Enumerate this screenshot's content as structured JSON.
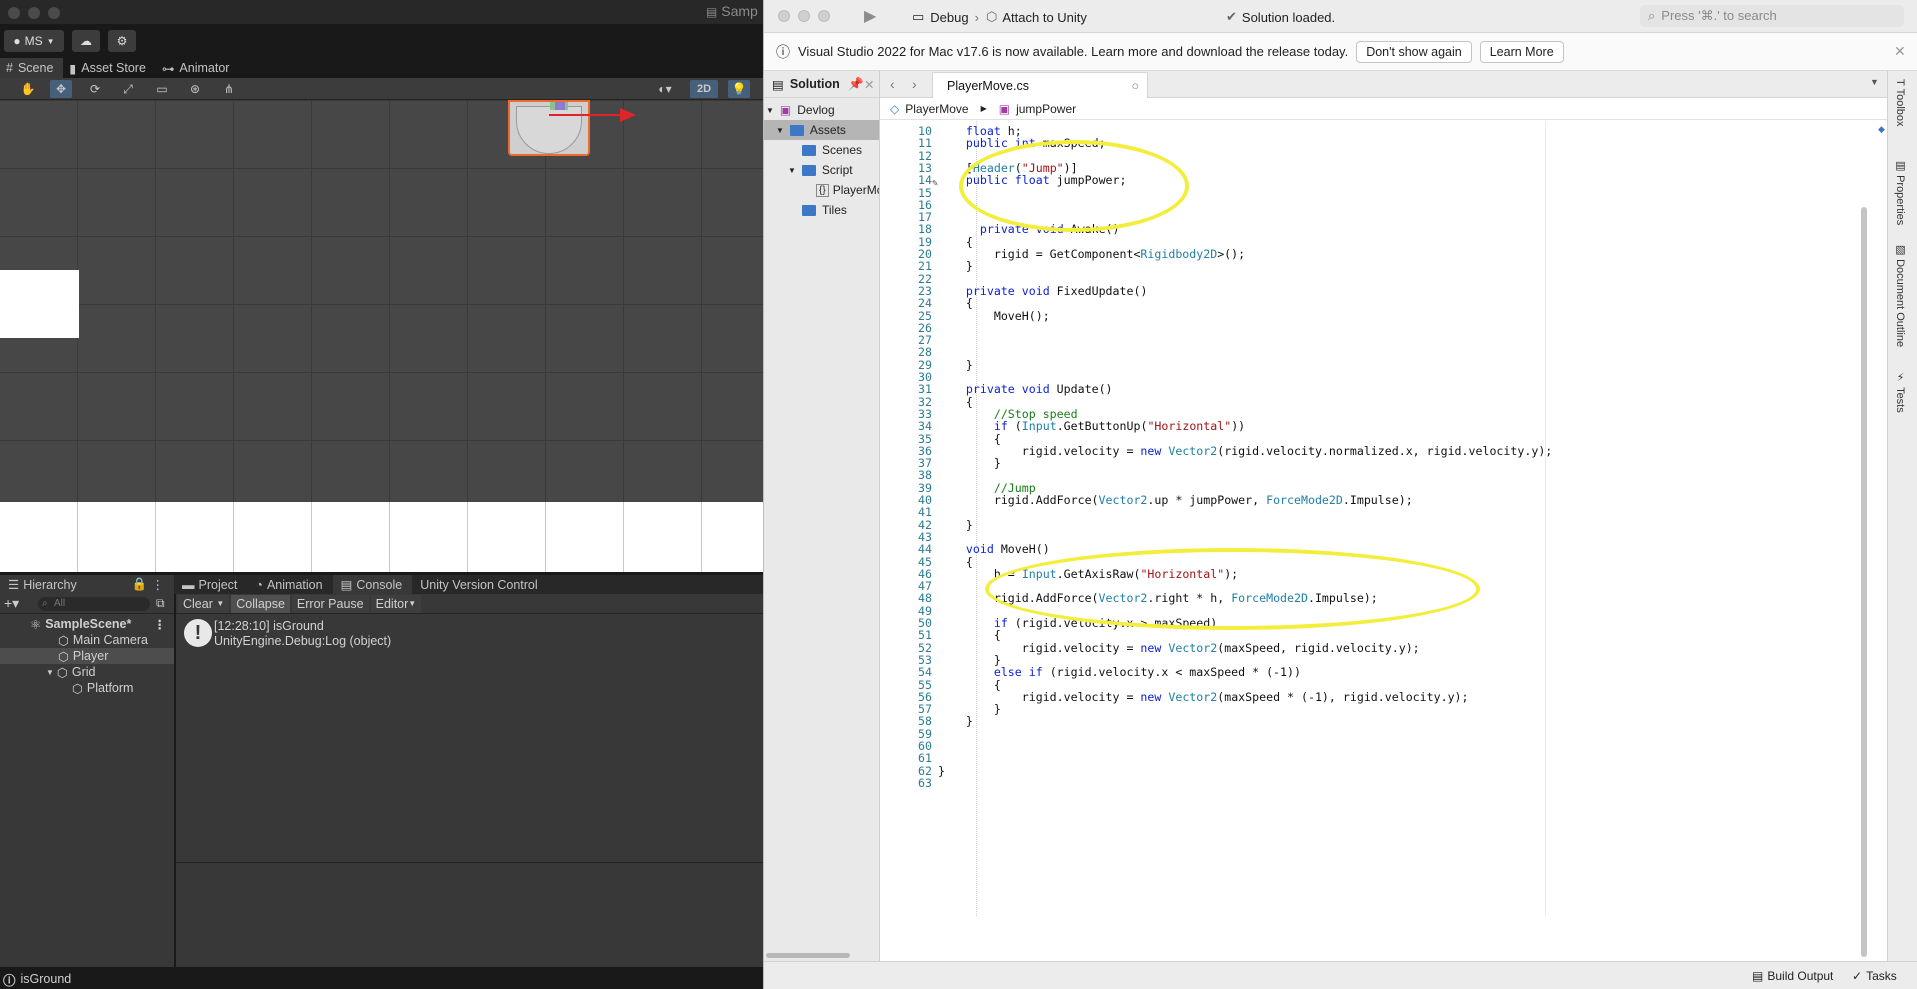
{
  "unity": {
    "window_title": "Samp",
    "account": "MS",
    "scene_tabs": [
      "Scene",
      "Asset Store",
      "Animator"
    ],
    "mode_2d": "2D",
    "bottom_tabs": [
      "Hierarchy",
      "Project",
      "Animation",
      "Console",
      "Unity Version Control"
    ],
    "hierarchy_search_placeholder": "All",
    "hierarchy_items": [
      {
        "label": "SampleScene*",
        "icon": "unity-scene-icon",
        "level": 0
      },
      {
        "label": "Main Camera",
        "icon": "gameobject-icon",
        "level": 1
      },
      {
        "label": "Player",
        "icon": "gameobject-icon",
        "level": 1,
        "selected": true
      },
      {
        "label": "Grid",
        "icon": "gameobject-icon",
        "level": 1
      },
      {
        "label": "Platform",
        "icon": "gameobject-icon",
        "level": 2
      }
    ],
    "console_buttons": [
      "Clear",
      "Collapse",
      "Error Pause",
      "Editor"
    ],
    "console_log": {
      "line1": "[12:28:10] isGround",
      "line2": "UnityEngine.Debug:Log (object)"
    },
    "status_text": "isGround"
  },
  "vs": {
    "config": "Debug",
    "target": "Attach to Unity",
    "status": "Solution loaded.",
    "search_placeholder": "Press '⌘.' to search",
    "info_message": "Visual Studio 2022 for Mac v17.6 is now available. Learn more and download the release today.",
    "info_buttons": [
      "Don't show again",
      "Learn More"
    ],
    "solution_title": "Solution",
    "solution_items": [
      {
        "label": "Devlog",
        "level": 0,
        "kind": "solution"
      },
      {
        "label": "Assets",
        "level": 1,
        "kind": "folder",
        "selected": true
      },
      {
        "label": "Scenes",
        "level": 2,
        "kind": "folder"
      },
      {
        "label": "Script",
        "level": 2,
        "kind": "folder"
      },
      {
        "label": "PlayerMc",
        "level": 3,
        "kind": "file"
      },
      {
        "label": "Tiles",
        "level": 2,
        "kind": "folder"
      }
    ],
    "tab_label": "PlayerMove.cs",
    "breadcrumb": [
      "PlayerMove",
      "jumpPower"
    ],
    "right_panels": [
      "Toolbox",
      "Properties",
      "Document Outline",
      "Tests"
    ],
    "bottom_buttons": [
      "Build Output",
      "Tasks"
    ],
    "code_lines": [
      {
        "n": 10,
        "t": "    float h;"
      },
      {
        "n": 11,
        "t": "    public int maxSpeed;"
      },
      {
        "n": 12,
        "t": ""
      },
      {
        "n": 13,
        "t": "    [Header(\"Jump\")]"
      },
      {
        "n": 14,
        "t": "    public float jumpPower;"
      },
      {
        "n": 15,
        "t": ""
      },
      {
        "n": 16,
        "t": ""
      },
      {
        "n": 17,
        "t": ""
      },
      {
        "n": 18,
        "t": "      private void Awake()"
      },
      {
        "n": 19,
        "t": "    {"
      },
      {
        "n": 20,
        "t": "        rigid = GetComponent<Rigidbody2D>();"
      },
      {
        "n": 21,
        "t": "    }"
      },
      {
        "n": 22,
        "t": ""
      },
      {
        "n": 23,
        "t": "    private void FixedUpdate()"
      },
      {
        "n": 24,
        "t": "    {"
      },
      {
        "n": 25,
        "t": "        MoveH();"
      },
      {
        "n": 26,
        "t": ""
      },
      {
        "n": 27,
        "t": ""
      },
      {
        "n": 28,
        "t": ""
      },
      {
        "n": 29,
        "t": "    }"
      },
      {
        "n": 30,
        "t": ""
      },
      {
        "n": 31,
        "t": "    private void Update()"
      },
      {
        "n": 32,
        "t": "    {"
      },
      {
        "n": 33,
        "t": "        //Stop speed"
      },
      {
        "n": 34,
        "t": "        if (Input.GetButtonUp(\"Horizontal\"))"
      },
      {
        "n": 35,
        "t": "        {"
      },
      {
        "n": 36,
        "t": "            rigid.velocity = new Vector2(rigid.velocity.normalized.x, rigid.velocity.y);"
      },
      {
        "n": 37,
        "t": "        }"
      },
      {
        "n": 38,
        "t": ""
      },
      {
        "n": 39,
        "t": "        //Jump"
      },
      {
        "n": 40,
        "t": "        rigid.AddForce(Vector2.up * jumpPower, ForceMode2D.Impulse);"
      },
      {
        "n": 41,
        "t": ""
      },
      {
        "n": 42,
        "t": "    }"
      },
      {
        "n": 43,
        "t": ""
      },
      {
        "n": 44,
        "t": "    void MoveH()"
      },
      {
        "n": 45,
        "t": "    {"
      },
      {
        "n": 46,
        "t": "        h = Input.GetAxisRaw(\"Horizontal\");"
      },
      {
        "n": 47,
        "t": ""
      },
      {
        "n": 48,
        "t": "        rigid.AddForce(Vector2.right * h, ForceMode2D.Impulse);"
      },
      {
        "n": 49,
        "t": ""
      },
      {
        "n": 50,
        "t": "        if (rigid.velocity.x > maxSpeed)"
      },
      {
        "n": 51,
        "t": "        {"
      },
      {
        "n": 52,
        "t": "            rigid.velocity = new Vector2(maxSpeed, rigid.velocity.y);"
      },
      {
        "n": 53,
        "t": "        }"
      },
      {
        "n": 54,
        "t": "        else if (rigid.velocity.x < maxSpeed * (-1))"
      },
      {
        "n": 55,
        "t": "        {"
      },
      {
        "n": 56,
        "t": "            rigid.velocity = new Vector2(maxSpeed * (-1), rigid.velocity.y);"
      },
      {
        "n": 57,
        "t": "        }"
      },
      {
        "n": 58,
        "t": "    }"
      },
      {
        "n": 59,
        "t": ""
      },
      {
        "n": 60,
        "t": ""
      },
      {
        "n": 61,
        "t": ""
      },
      {
        "n": 62,
        "t": "}"
      },
      {
        "n": 63,
        "t": ""
      }
    ]
  },
  "colors": {
    "highlight": "#f3ee3c",
    "vs_keyword": "#0b21d8",
    "vs_type": "#1f7fa5",
    "vs_string": "#a31515",
    "vs_comment": "#167d16",
    "unity_selection": "#46607c",
    "player_outline": "#ef6a2e"
  }
}
